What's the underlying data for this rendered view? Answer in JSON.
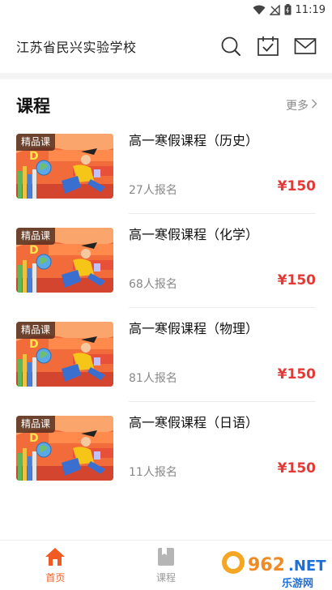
{
  "status_bar": {
    "time": "11:19"
  },
  "header": {
    "school_name": "江苏省民兴实验学校",
    "icons": [
      "search-icon",
      "calendar-check-icon",
      "mail-icon"
    ]
  },
  "section": {
    "title": "课程",
    "more_label": "更多"
  },
  "courses": [
    {
      "badge": "精品课",
      "title": "高一寒假课程（历史）",
      "enrolled": "27人报名",
      "price": "¥150"
    },
    {
      "badge": "精品课",
      "title": "高一寒假课程（化学）",
      "enrolled": "68人报名",
      "price": "¥150"
    },
    {
      "badge": "精品课",
      "title": "高一寒假课程（物理）",
      "enrolled": "81人报名",
      "price": "¥150"
    },
    {
      "badge": "精品课",
      "title": "高一寒假课程（日语）",
      "enrolled": "11人报名",
      "price": "¥150"
    }
  ],
  "bottom_nav": {
    "items": [
      {
        "label": "首页",
        "icon": "home-icon",
        "active": true
      },
      {
        "label": "课程",
        "icon": "book-icon",
        "active": false
      }
    ]
  },
  "watermark": {
    "logo_text": "962.NET",
    "sub_text": "乐游网"
  },
  "colors": {
    "accent": "#f15a22",
    "price": "#e53935"
  }
}
